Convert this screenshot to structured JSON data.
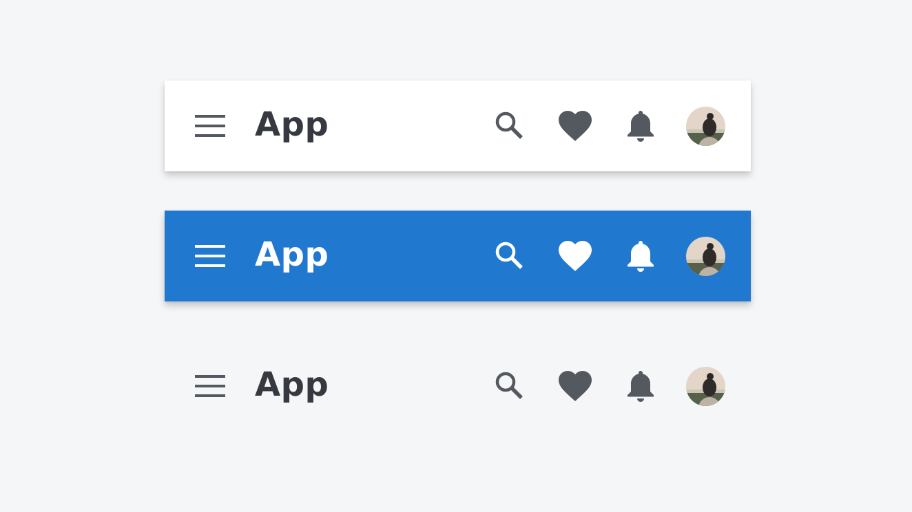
{
  "bars": [
    {
      "variant": "white",
      "title": "App",
      "icon_color": "#545960",
      "background": "#ffffff"
    },
    {
      "variant": "blue",
      "title": "App",
      "icon_color": "#ffffff",
      "background": "#2179cf"
    },
    {
      "variant": "transparent",
      "title": "App",
      "icon_color": "#545960",
      "background": "transparent"
    }
  ],
  "icons": [
    "menu-icon",
    "search-icon",
    "heart-icon",
    "bell-icon",
    "avatar"
  ]
}
